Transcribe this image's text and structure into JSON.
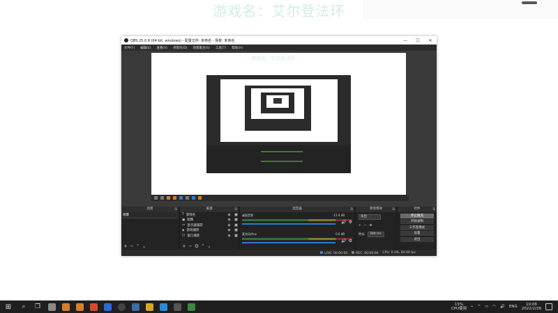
{
  "desktop": {
    "watermark": "游戏名：艾尔登法环"
  },
  "obs_window": {
    "title": "OBS 25.0.8 (64-bit, windows) - 配置文件: 未命名 - 场景: 未命名",
    "window_controls": {
      "minimize": "—",
      "maximize": "☐",
      "close": "✕"
    },
    "menu": [
      "文件(F)",
      "编辑(E)",
      "查看(V)",
      "停靠坞(D)",
      "场景集合(S)",
      "工具(T)",
      "帮助(H)"
    ],
    "preview_watermark": "游戏名：艾尔登法环",
    "docks": {
      "scenes": {
        "header": "场景",
        "items": [
          "场景"
        ]
      },
      "sources": {
        "header": "来源",
        "items": [
          {
            "label": "游戏名",
            "icon": "text-icon"
          },
          {
            "label": "图像",
            "icon": "image-icon"
          },
          {
            "label": "显示器捕获",
            "icon": "monitor-icon"
          },
          {
            "label": "游戏捕获",
            "icon": "gamepad-icon"
          },
          {
            "label": "窗口捕获",
            "icon": "window-icon"
          }
        ]
      },
      "mixer": {
        "header": "混音器",
        "tracks": [
          {
            "name": "桌面音频",
            "db": "-11.4 dB",
            "level": 0.85
          },
          {
            "name": "麦克风/Aux",
            "db": "0.0 dB",
            "level": 0.85
          }
        ]
      },
      "transitions": {
        "header": "转场特效",
        "type": "淡出",
        "duration_label": "时长",
        "duration_value": "300 ms"
      },
      "controls": {
        "header": "控件",
        "buttons": [
          "停止推流",
          "开始录制",
          "工作室模式",
          "设置",
          "退出"
        ]
      }
    },
    "status": {
      "live": "LIVE: 00:00:00",
      "rec": "REC: 00:00:00",
      "cpu": "CPU: 0.3%, 60.00 fps"
    }
  },
  "taskbar": {
    "cpu_percent": "15%",
    "cpu_label": "CPU使用",
    "language": "ENG",
    "time": "10:08",
    "date": "2022/2/28"
  }
}
